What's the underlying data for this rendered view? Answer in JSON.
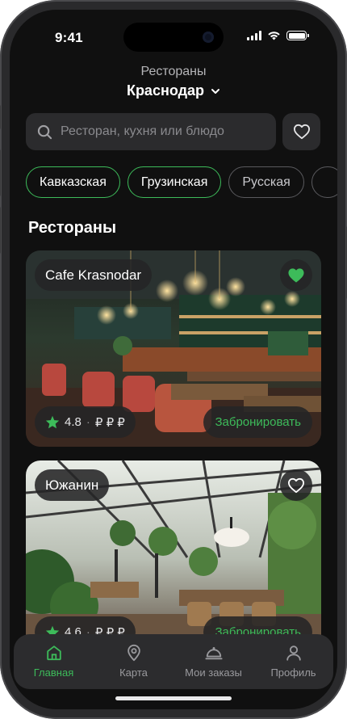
{
  "status_bar": {
    "time": "9:41"
  },
  "header": {
    "subtitle": "Рестораны",
    "city": "Краснодар"
  },
  "search": {
    "placeholder": "Ресторан, кухня или блюдо"
  },
  "chips": [
    {
      "label": "Кавказская",
      "active": true
    },
    {
      "label": "Грузинская",
      "active": true
    },
    {
      "label": "Русская",
      "active": false
    }
  ],
  "section_title": "Рестораны",
  "restaurants": [
    {
      "name": "Cafe Krasnodar",
      "rating": "4.8",
      "price": "₽ ₽ ₽",
      "book_label": "Забронировать",
      "favorite": true
    },
    {
      "name": "Южанин",
      "rating": "4.6",
      "price": "₽ ₽ ₽",
      "book_label": "Забронировать",
      "favorite": false
    }
  ],
  "tabbar": {
    "items": [
      {
        "label": "Главная",
        "icon": "home-icon",
        "active": true
      },
      {
        "label": "Карта",
        "icon": "map-pin-icon",
        "active": false
      },
      {
        "label": "Мои заказы",
        "icon": "cloche-icon",
        "active": false
      },
      {
        "label": "Профиль",
        "icon": "profile-icon",
        "active": false
      }
    ]
  },
  "colors": {
    "accent": "#3dbb5a",
    "background": "#101010",
    "surface": "#2b2b2d"
  }
}
